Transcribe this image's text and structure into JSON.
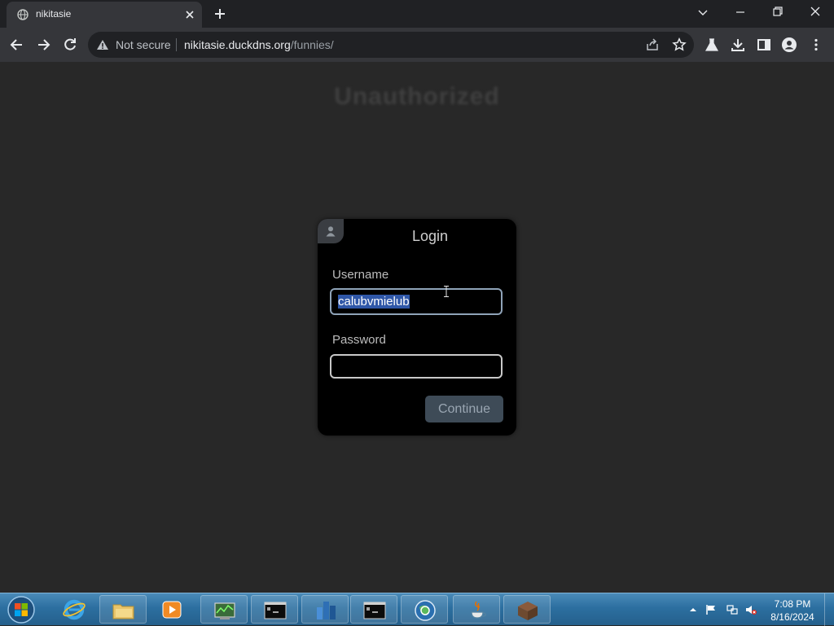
{
  "browser": {
    "tab_title": "nikitasie",
    "tab_close_icon": "close-icon",
    "new_tab_icon": "plus-icon",
    "security_label": "Not secure",
    "url_host": "nikitasie.duckdns.org",
    "url_path": "/funnies/"
  },
  "page": {
    "heading": "Unauthorized",
    "login": {
      "title": "Login",
      "username_label": "Username",
      "username_value": "calubvmielub",
      "password_label": "Password",
      "password_value": "",
      "continue_label": "Continue"
    }
  },
  "taskbar": {
    "clock_time": "7:08 PM",
    "clock_date": "8/16/2024"
  },
  "colors": {
    "page_bg": "#282828",
    "card_bg": "#000000",
    "selection": "#2f57a8",
    "taskbar": "#2c6fa0"
  }
}
